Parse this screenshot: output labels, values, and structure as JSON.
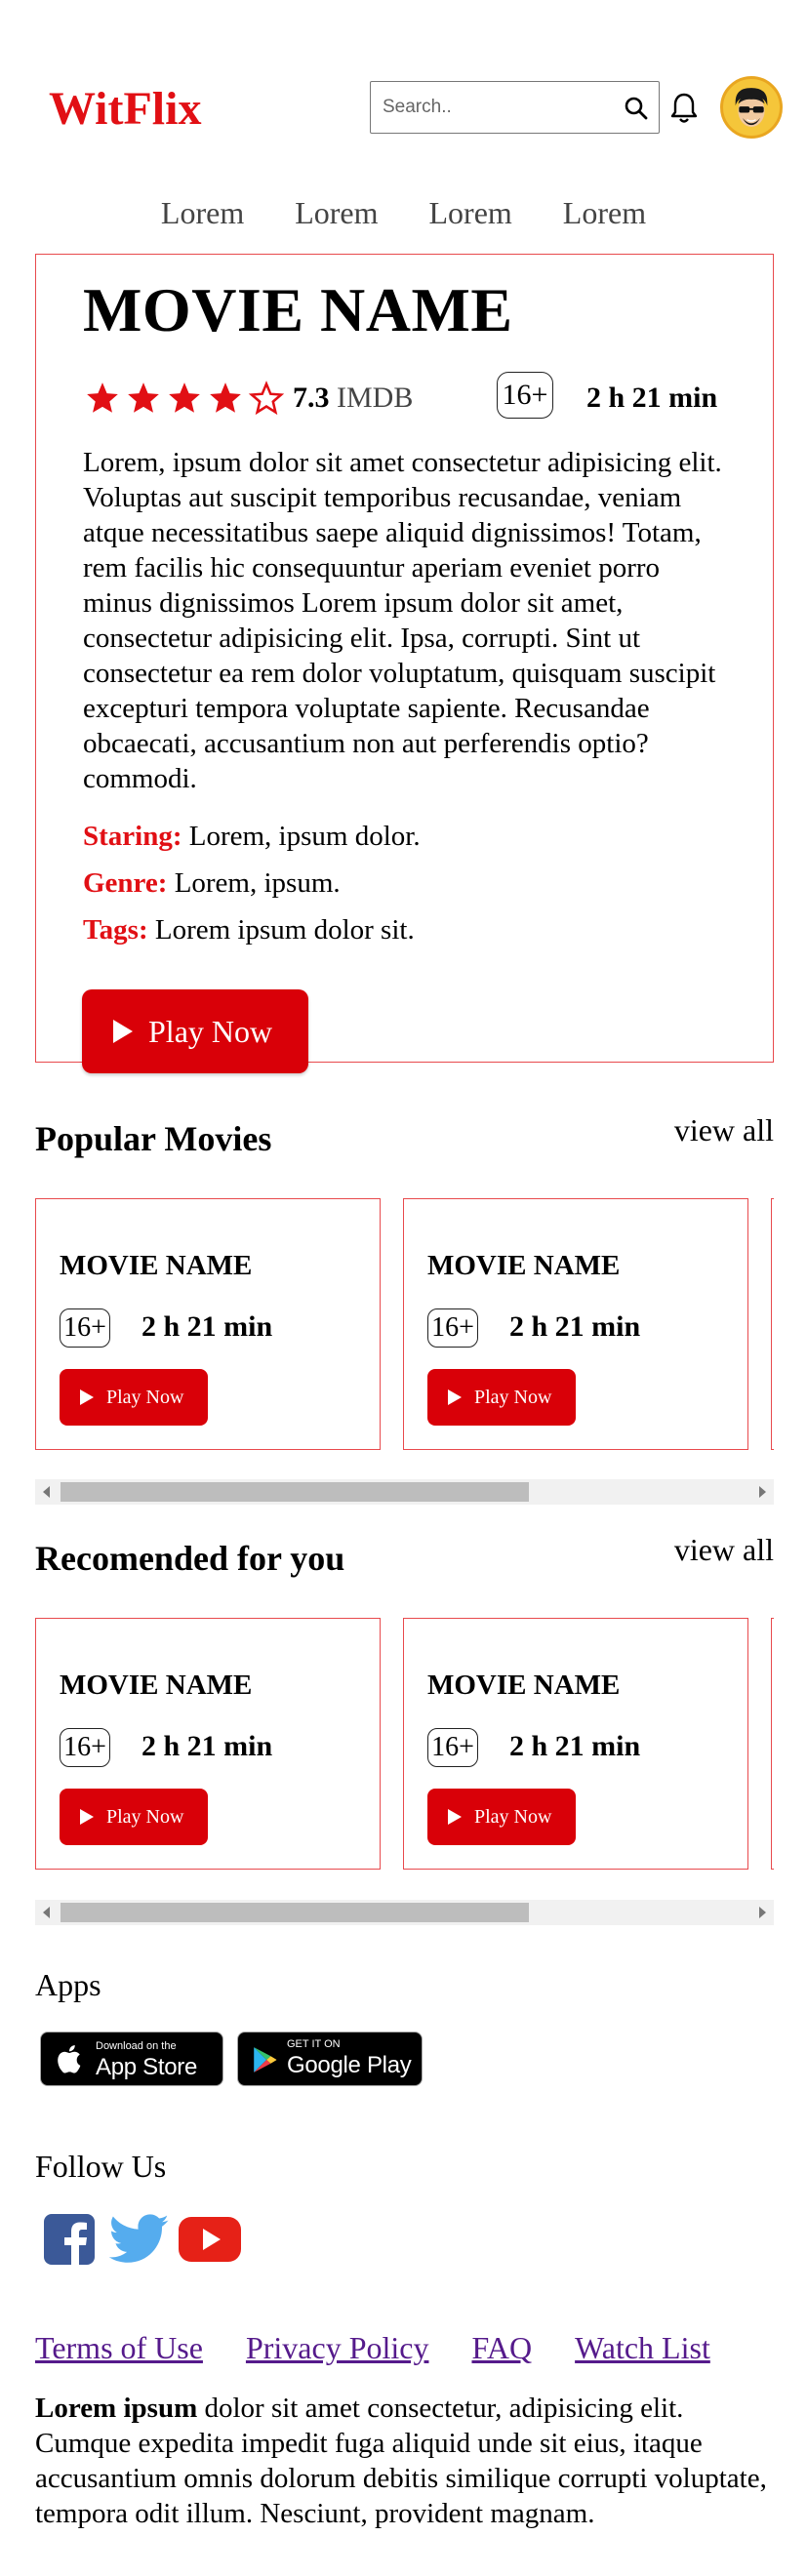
{
  "brand": {
    "logo": "WitFlix",
    "accent": "#e10f14"
  },
  "search": {
    "placeholder": "Search.."
  },
  "nav": [
    "Lorem",
    "Lorem",
    "Lorem",
    "Lorem"
  ],
  "hero": {
    "title": "MOVIE NAME",
    "rating_stars": 4,
    "rating_max": 5,
    "imdb_score": "7.3",
    "imdb_label": "IMDB",
    "age": "16+",
    "duration": "2 h 21 min",
    "description": "Lorem, ipsum dolor sit amet consectetur adipisicing elit. Voluptas aut suscipit temporibus recusandae, veniam atque necessitatibus saepe aliquid dignissimos! Totam, rem facilis hic consequuntur aperiam eveniet porro minus dignissimos Lorem ipsum dolor sit amet, consectetur adipisicing elit. Ipsa, corrupti. Sint ut consectetur ea rem dolor voluptatum, quisquam suscipit excepturi tempora voluptate sapiente. Recusandae obcaecati, accusantium non aut perferendis optio?commodi.",
    "staring_label": "Staring:",
    "staring_value": "Lorem, ipsum dolor.",
    "genre_label": "Genre:",
    "genre_value": "Lorem, ipsum.",
    "tags_label": "Tags:",
    "tags_value": "Lorem ipsum dolor sit.",
    "play_label": "Play Now"
  },
  "popular": {
    "title": "Popular Movies",
    "view_all": "view all",
    "cards": [
      {
        "name": "MOVIE NAME",
        "age": "16+",
        "duration": "2 h 21 min",
        "play": "Play Now"
      },
      {
        "name": "MOVIE NAME",
        "age": "16+",
        "duration": "2 h 21 min",
        "play": "Play Now"
      }
    ]
  },
  "recommended": {
    "title": "Recomended for you",
    "view_all": "view all",
    "cards": [
      {
        "name": "MOVIE NAME",
        "age": "16+",
        "duration": "2 h 21 min",
        "play": "Play Now"
      },
      {
        "name": "MOVIE NAME",
        "age": "16+",
        "duration": "2 h 21 min",
        "play": "Play Now"
      }
    ]
  },
  "footer": {
    "apps_label": "Apps",
    "appstore_small": "Download on the",
    "appstore_big": "App Store",
    "googleplay_small": "GET IT ON",
    "googleplay_big": "Google Play",
    "follow_label": "Follow Us",
    "social_icons": [
      "facebook-icon",
      "twitter-icon",
      "youtube-icon"
    ],
    "links": [
      "Terms of Use",
      "Privacy Policy",
      "FAQ",
      "Watch List"
    ],
    "about_bold": "Lorem ipsum",
    "about_text": " dolor sit amet consectetur, adipisicing elit. Cumque expedita impedit fuga aliquid unde sit eius, itaque accusantium omnis dolorum debitis similique corrupti voluptate, tempora odit illum. Nesciunt, provident magnam."
  }
}
